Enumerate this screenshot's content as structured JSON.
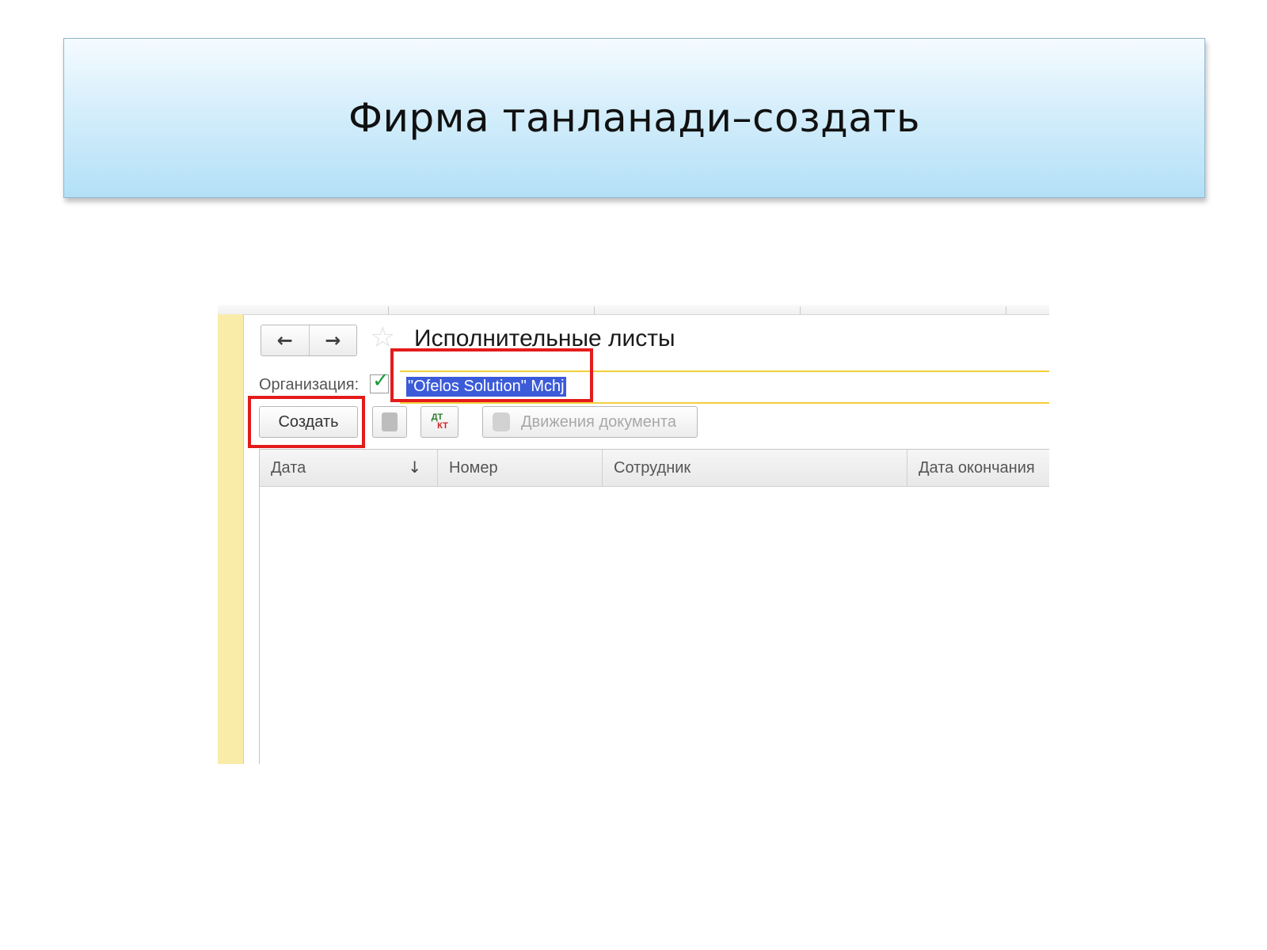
{
  "slide": {
    "title": "Фирма танланади–создать"
  },
  "window": {
    "nav_back_icon": "arrow-left-icon",
    "nav_forward_icon": "arrow-right-icon",
    "favorite_icon": "star-icon",
    "title": "Исполнительные листы"
  },
  "filter": {
    "organization_label": "Организация:",
    "organization_checked": true,
    "organization_value": "\"Ofelos Solution\" Mchj"
  },
  "toolbar": {
    "create_label": "Создать",
    "post_icon": "post-document-icon",
    "dtkt_dt": "ДТ",
    "dtkt_kt": "КТ",
    "movements_label": "Движения документа"
  },
  "table": {
    "columns": [
      "Дата",
      "Номер",
      "Сотрудник",
      "Дата окончания"
    ],
    "sort_icon": "sort-down-icon",
    "rows": []
  },
  "colors": {
    "highlight": "#e41b1b",
    "selection": "#3c5bd9",
    "input_border": "#f3cf3a",
    "side_bar": "#f9eca8"
  }
}
